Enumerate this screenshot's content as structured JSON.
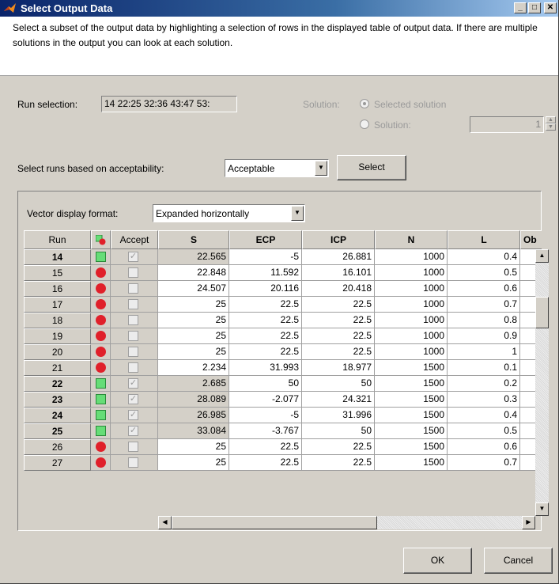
{
  "window": {
    "title": "Select Output Data",
    "minimize": "_",
    "maximize": "□",
    "close": "✕"
  },
  "description": "Select a subset of the output data by highlighting a selection of rows in the displayed table of output data.  If there are multiple solutions in the output you can look at each solution.",
  "run_selection": {
    "label": "Run selection:",
    "value": "14 22:25 32:36 43:47 53:"
  },
  "solution": {
    "label": "Solution:",
    "selected_label": "Selected solution",
    "solution_label": "Solution:",
    "value": "1"
  },
  "acceptability": {
    "label": "Select runs based on acceptability:",
    "selected": "Acceptable",
    "button": "Select"
  },
  "vector_format": {
    "label": "Vector display format:",
    "selected": "Expanded horizontally"
  },
  "table": {
    "headers": [
      "Run",
      "",
      "Accept",
      "S",
      "ECP",
      "ICP",
      "N",
      "L",
      "Ob"
    ],
    "rows": [
      {
        "run": "14",
        "ok": true,
        "s": "22.565",
        "ecp": "-5",
        "icp": "26.881",
        "n": "1000",
        "l": "0.4"
      },
      {
        "run": "15",
        "ok": false,
        "s": "22.848",
        "ecp": "11.592",
        "icp": "16.101",
        "n": "1000",
        "l": "0.5"
      },
      {
        "run": "16",
        "ok": false,
        "s": "24.507",
        "ecp": "20.116",
        "icp": "20.418",
        "n": "1000",
        "l": "0.6"
      },
      {
        "run": "17",
        "ok": false,
        "s": "25",
        "ecp": "22.5",
        "icp": "22.5",
        "n": "1000",
        "l": "0.7"
      },
      {
        "run": "18",
        "ok": false,
        "s": "25",
        "ecp": "22.5",
        "icp": "22.5",
        "n": "1000",
        "l": "0.8"
      },
      {
        "run": "19",
        "ok": false,
        "s": "25",
        "ecp": "22.5",
        "icp": "22.5",
        "n": "1000",
        "l": "0.9"
      },
      {
        "run": "20",
        "ok": false,
        "s": "25",
        "ecp": "22.5",
        "icp": "22.5",
        "n": "1000",
        "l": "1"
      },
      {
        "run": "21",
        "ok": false,
        "s": "2.234",
        "ecp": "31.993",
        "icp": "18.977",
        "n": "1500",
        "l": "0.1"
      },
      {
        "run": "22",
        "ok": true,
        "s": "2.685",
        "ecp": "50",
        "icp": "50",
        "n": "1500",
        "l": "0.2"
      },
      {
        "run": "23",
        "ok": true,
        "s": "28.089",
        "ecp": "-2.077",
        "icp": "24.321",
        "n": "1500",
        "l": "0.3"
      },
      {
        "run": "24",
        "ok": true,
        "s": "26.985",
        "ecp": "-5",
        "icp": "31.996",
        "n": "1500",
        "l": "0.4"
      },
      {
        "run": "25",
        "ok": true,
        "s": "33.084",
        "ecp": "-3.767",
        "icp": "50",
        "n": "1500",
        "l": "0.5"
      },
      {
        "run": "26",
        "ok": false,
        "s": "25",
        "ecp": "22.5",
        "icp": "22.5",
        "n": "1500",
        "l": "0.6"
      },
      {
        "run": "27",
        "ok": false,
        "s": "25",
        "ecp": "22.5",
        "icp": "22.5",
        "n": "1500",
        "l": "0.7"
      }
    ]
  },
  "buttons": {
    "ok": "OK",
    "cancel": "Cancel"
  },
  "colors": {
    "accept_green": "#66dd77",
    "reject_red": "#e0202a",
    "title_blue": "#0a246a"
  }
}
